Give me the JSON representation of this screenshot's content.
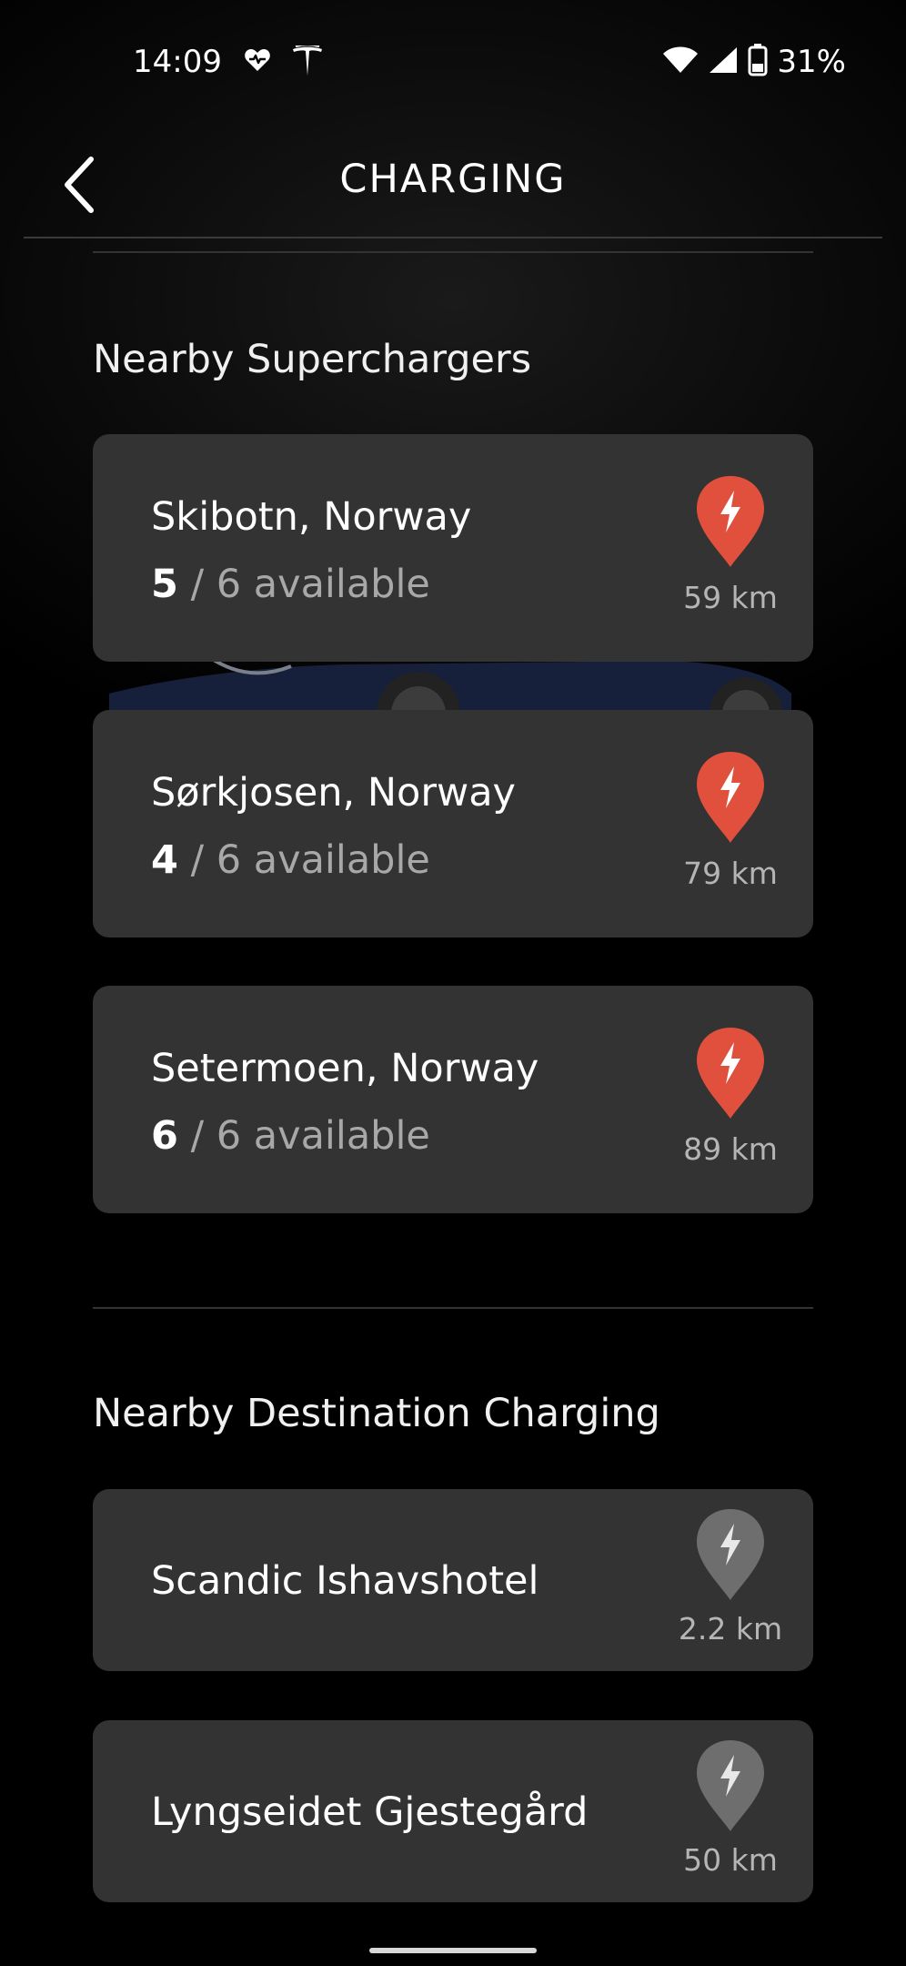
{
  "status_bar": {
    "time": "14:09",
    "battery_percent": "31%",
    "icons": [
      "heart-rate-icon",
      "tesla-logo-icon",
      "wifi-icon",
      "cell-signal-icon",
      "battery-icon"
    ]
  },
  "header": {
    "title": "CHARGING",
    "back_icon": "chevron-left-icon"
  },
  "superchargers": {
    "title": "Nearby Superchargers",
    "items": [
      {
        "name": "Skibotn, Norway",
        "available": "5",
        "total_text": " / 6 available",
        "distance": "59 km"
      },
      {
        "name": "Sørkjosen, Norway",
        "available": "4",
        "total_text": " / 6 available",
        "distance": "79 km"
      },
      {
        "name": "Setermoen, Norway",
        "available": "6",
        "total_text": " / 6 available",
        "distance": "89 km"
      }
    ]
  },
  "destination": {
    "title": "Nearby Destination Charging",
    "items": [
      {
        "name": "Scandic Ishavshotel",
        "distance": "2.2 km"
      },
      {
        "name": "Lyngseidet Gjestegård",
        "distance": "50 km"
      }
    ]
  },
  "colors": {
    "supercharger_pin": "#e0503d",
    "destination_pin": "#6e6e6e",
    "card_bg": "#333333",
    "background": "#000000"
  }
}
